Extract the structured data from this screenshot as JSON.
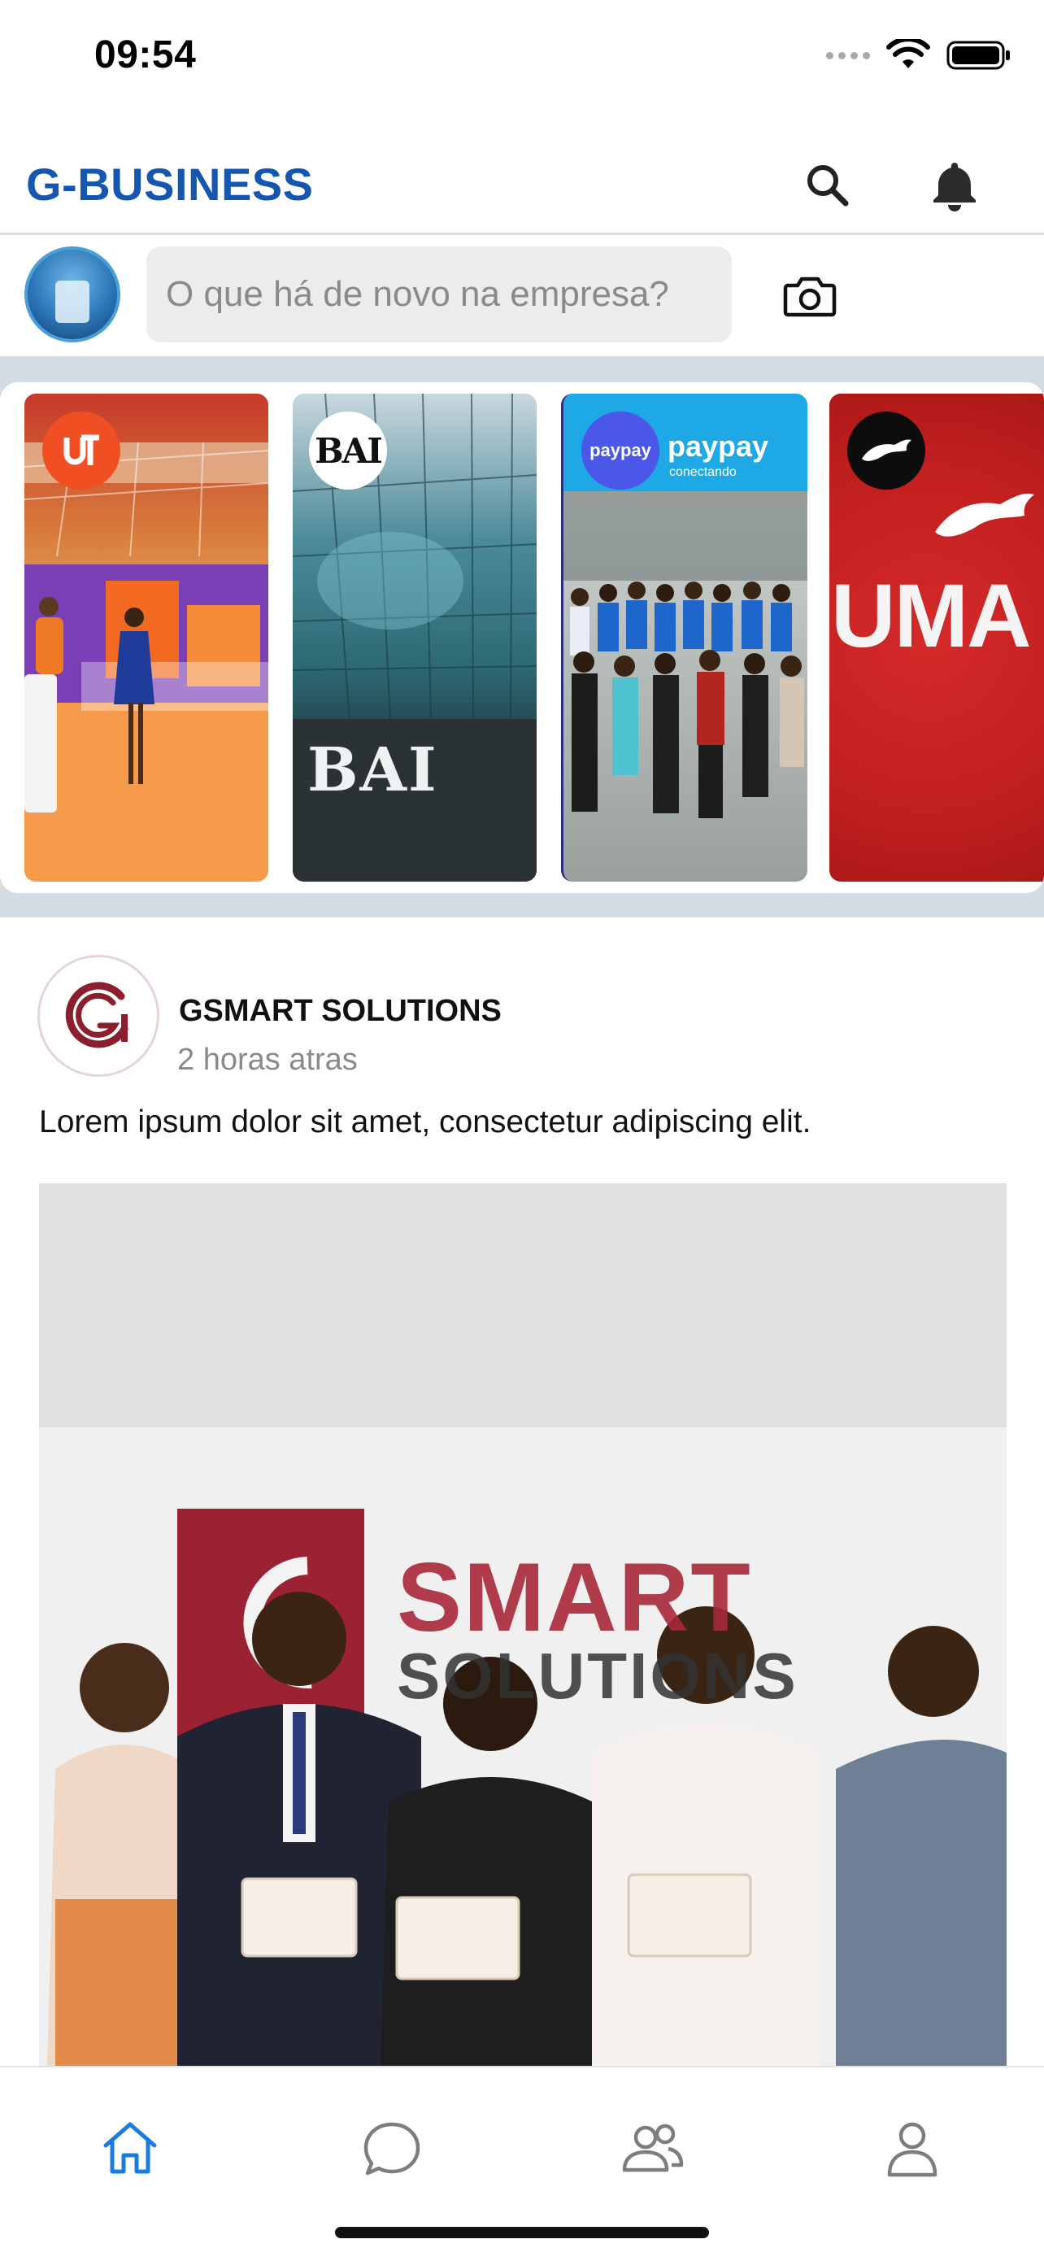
{
  "status_bar": {
    "time": "09:54"
  },
  "header": {
    "title": "G-BUSINESS"
  },
  "composer": {
    "placeholder": "O que há de novo na empresa?"
  },
  "stories": [
    {
      "brand": "unitel",
      "logo_text": ""
    },
    {
      "brand": "bai",
      "logo_text": "BAI",
      "sign_text": "BAI"
    },
    {
      "brand": "paypay",
      "logo_text": "paypay",
      "sign_text": "paypay",
      "sign_sub": "conectando"
    },
    {
      "brand": "puma",
      "logo_text": "",
      "sign_text": "UMA"
    }
  ],
  "post": {
    "author": "GSMART SOLUTIONS",
    "time": "2 horas atras",
    "text": "Lorem ipsum dolor sit amet, consectetur adipiscing elit.",
    "image": {
      "wall_line1": "SMART",
      "wall_line2": "SOLUTIONS"
    }
  },
  "bottom_nav": {
    "items": [
      {
        "id": "home",
        "icon": "home-icon",
        "active": true
      },
      {
        "id": "chat",
        "icon": "chat-icon",
        "active": false
      },
      {
        "id": "groups",
        "icon": "people-icon",
        "active": false
      },
      {
        "id": "profile",
        "icon": "person-icon",
        "active": false
      }
    ]
  },
  "colors": {
    "brand_blue": "#1557b0",
    "nav_active": "#1a7be0",
    "nav_inactive": "#7d7d7d",
    "band": "#d4dde3"
  }
}
